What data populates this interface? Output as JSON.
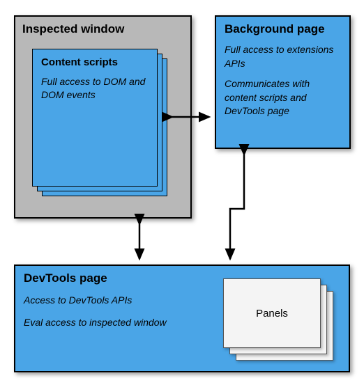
{
  "inspected_window": {
    "title": "Inspected window",
    "content_scripts": {
      "title": "Content scripts",
      "body": "Full access to DOM and DOM events"
    }
  },
  "background_page": {
    "title": "Background page",
    "body1": "Full access to extensions APIs",
    "body2": "Communicates with content scripts and DevTools page"
  },
  "devtools_page": {
    "title": "DevTools page",
    "body1": "Access to DevTools APIs",
    "body2": "Eval access to inspected window",
    "panels_label": "Panels"
  },
  "colors": {
    "blue": "#4aa5e7",
    "gray": "#b8b8b8"
  }
}
